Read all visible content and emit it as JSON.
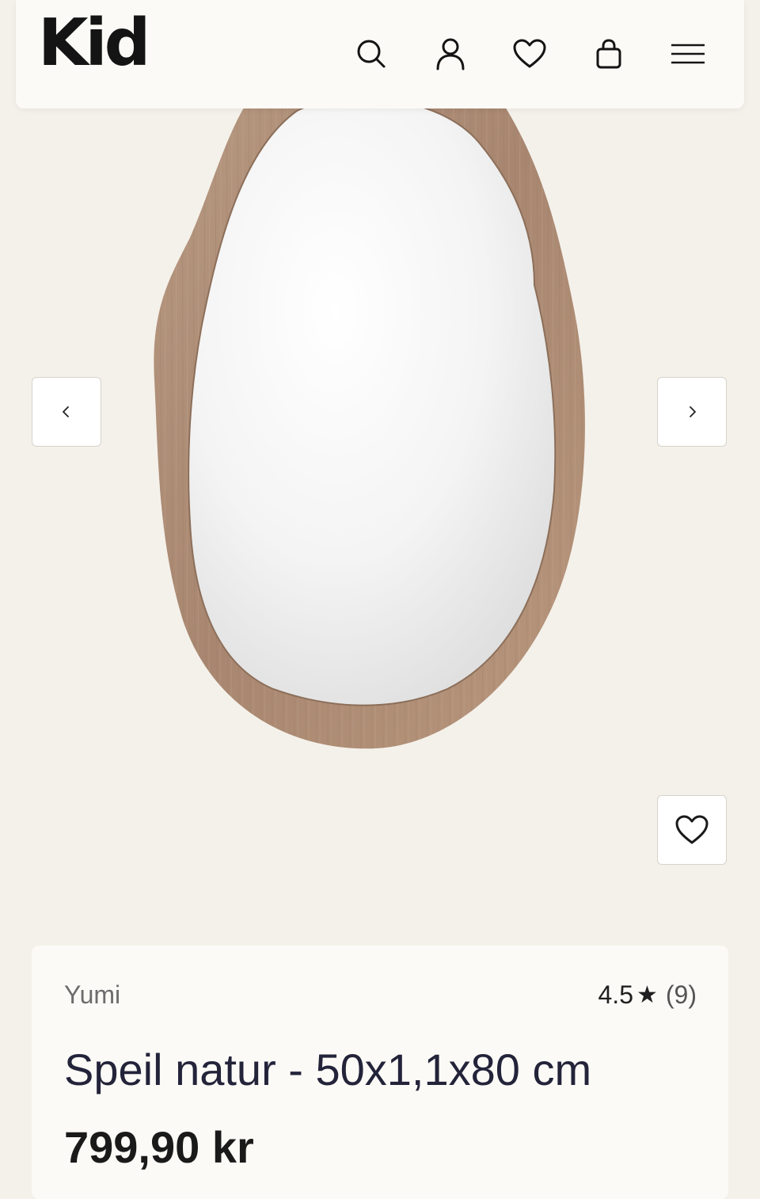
{
  "header": {
    "logo": "Kid",
    "icons": [
      "search-icon",
      "user-icon",
      "heart-icon",
      "bag-icon",
      "menu-icon"
    ]
  },
  "gallery": {
    "prev_icon": "chevron-left-icon",
    "next_icon": "chevron-right-icon",
    "favorite_icon": "heart-icon"
  },
  "product": {
    "brand": "Yumi",
    "rating": "4.5",
    "rating_star": "★",
    "review_count": "(9)",
    "title": "Speil natur - 50x1,1x80 cm",
    "price": "799,90 kr"
  },
  "colors": {
    "background": "#f4f1ea",
    "card": "#fbfaf6",
    "wood": "#b08f76"
  }
}
